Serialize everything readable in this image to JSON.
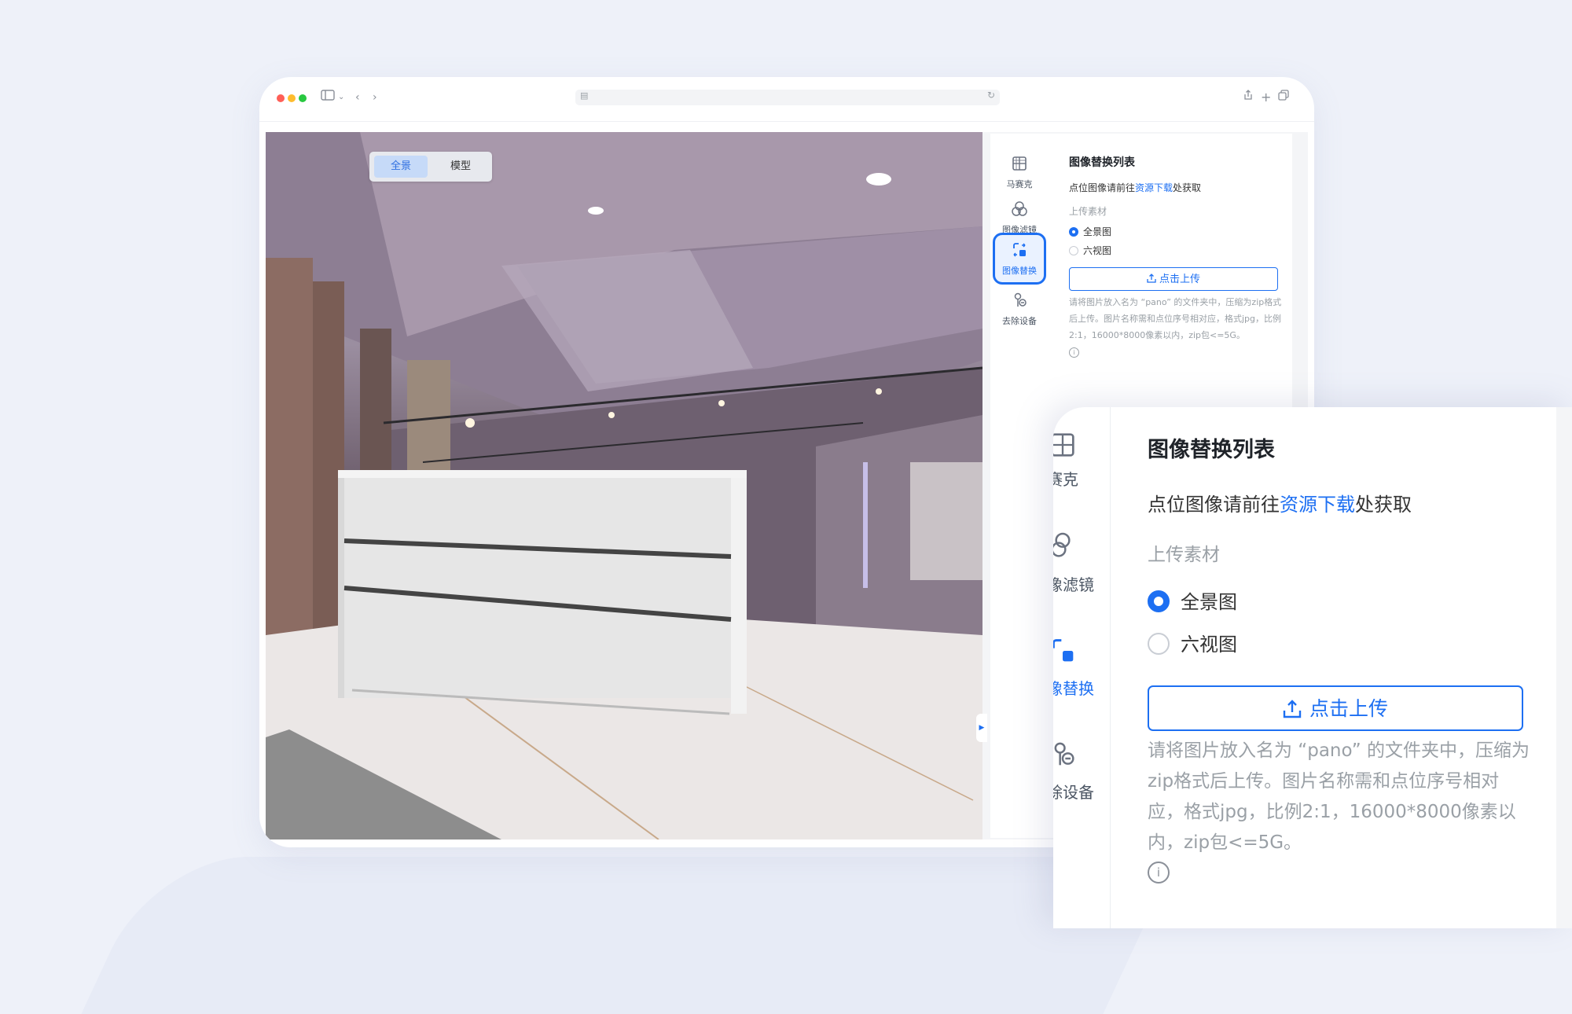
{
  "viewer": {
    "mode_tabs": [
      "全景",
      "模型"
    ],
    "active_mode": "全景"
  },
  "sidebar": {
    "items": [
      {
        "label": "马赛克",
        "icon": "mosaic-icon"
      },
      {
        "label": "图像滤镜",
        "icon": "filter-icon"
      },
      {
        "label": "图像替换",
        "icon": "image-replace-icon",
        "active": true
      },
      {
        "label": "去除设备",
        "icon": "remove-device-icon"
      }
    ]
  },
  "panel": {
    "title": "图像替换列表",
    "instruction_prefix": "点位图像请前往",
    "instruction_link": "资源下载",
    "instruction_suffix": "处获取",
    "upload_section_label": "上传素材",
    "radio_options": [
      "全景图",
      "六视图"
    ],
    "selected_option": "全景图",
    "upload_button": "点击上传",
    "hint": "请将图片放入名为 “pano” 的文件夹中，压缩为zip格式后上传。图片名称需和点位序号相对应，格式jpg，比例2:1，16000*8000像素以内，zip包<=5G。"
  },
  "zoom_callout": {
    "sidebar_labels": [
      "赛克",
      "像滤镜",
      "像替换",
      "除设备"
    ]
  },
  "colors": {
    "accent": "#1d6ff2",
    "background": "#eef1f9"
  }
}
